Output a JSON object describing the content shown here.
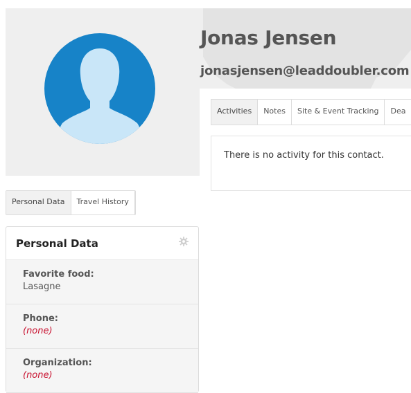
{
  "contact": {
    "name": "Jonas Jensen",
    "email": "jonasjensen@leaddoubler.com"
  },
  "activity_tabs": [
    {
      "label": "Activities",
      "active": true
    },
    {
      "label": "Notes",
      "active": false
    },
    {
      "label": "Site & Event Tracking",
      "active": false
    },
    {
      "label": "Dea",
      "active": false
    }
  ],
  "activity": {
    "empty_message": "There is no activity for this contact."
  },
  "left_tabs": [
    {
      "label": "Personal Data",
      "active": true
    },
    {
      "label": "Travel History",
      "active": false
    }
  ],
  "personal_data": {
    "title": "Personal Data",
    "settings_icon": "gear-icon",
    "fields": [
      {
        "label": "Favorite food:",
        "value": "Lasagne",
        "empty": false
      },
      {
        "label": "Phone:",
        "value": "(none)",
        "empty": true
      },
      {
        "label": "Organization:",
        "value": "(none)",
        "empty": true
      }
    ]
  },
  "colors": {
    "avatar_bg": "#1783c8",
    "avatar_fg": "#c9e6f8",
    "none_value": "#c8102e",
    "header_bg": "#efefef"
  }
}
